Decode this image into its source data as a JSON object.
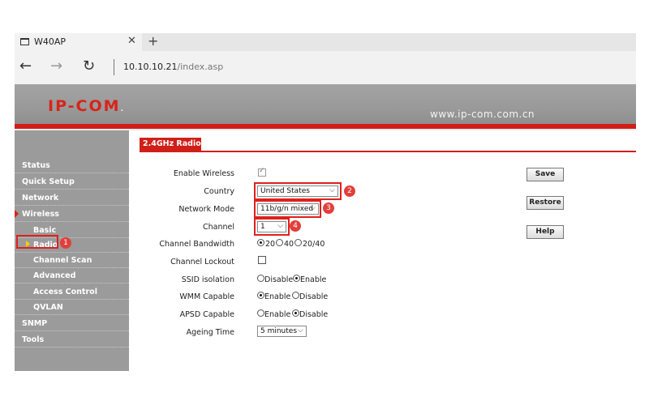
{
  "browser": {
    "tab_title": "W40AP",
    "tab_close": "✕",
    "tab_new": "+",
    "back": "←",
    "forward": "→",
    "refresh": "↻",
    "url_host": "10.10.10.21",
    "url_path": "/index.asp"
  },
  "banner": {
    "logo": "IP-COM",
    "logo_dot": ".",
    "site_url": "www.ip-com.com.cn"
  },
  "sidebar": {
    "items": [
      {
        "label": "Status"
      },
      {
        "label": "Quick Setup"
      },
      {
        "label": "Network"
      },
      {
        "label": "Wireless"
      },
      {
        "label": "Basic"
      },
      {
        "label": "Radio"
      },
      {
        "label": "Channel Scan"
      },
      {
        "label": "Advanced"
      },
      {
        "label": "Access Control"
      },
      {
        "label": "QVLAN"
      },
      {
        "label": "SNMP"
      },
      {
        "label": "Tools"
      }
    ]
  },
  "section_title": "2.4GHz Radio",
  "form": {
    "enable_wireless": {
      "label": "Enable Wireless",
      "checked": true
    },
    "country": {
      "label": "Country",
      "value": "United States"
    },
    "network_mode": {
      "label": "Network Mode",
      "value": "11b/g/n mixed"
    },
    "channel": {
      "label": "Channel",
      "value": "1"
    },
    "channel_bandwidth": {
      "label": "Channel Bandwidth",
      "options": [
        "20",
        "40",
        "20/40"
      ],
      "selected": "20"
    },
    "channel_lockout": {
      "label": "Channel Lockout",
      "checked": false
    },
    "ssid_isolation": {
      "label": "SSID isolation",
      "options": [
        "Disable",
        "Enable"
      ],
      "selected": "Enable"
    },
    "wmm_capable": {
      "label": "WMM Capable",
      "options": [
        "Enable",
        "Disable"
      ],
      "selected": "Enable"
    },
    "apsd_capable": {
      "label": "APSD Capable",
      "options": [
        "Enable",
        "Disable"
      ],
      "selected": "Disable"
    },
    "ageing_time": {
      "label": "Ageing Time",
      "value": "5 minutes"
    }
  },
  "buttons": {
    "save": "Save",
    "restore": "Restore",
    "help": "Help"
  },
  "markers": [
    "1",
    "2",
    "3",
    "4"
  ],
  "colors": {
    "accent_red": "#cf1f18",
    "highlight_red": "#e0201c",
    "sidebar_gray": "#9b9b9b"
  }
}
